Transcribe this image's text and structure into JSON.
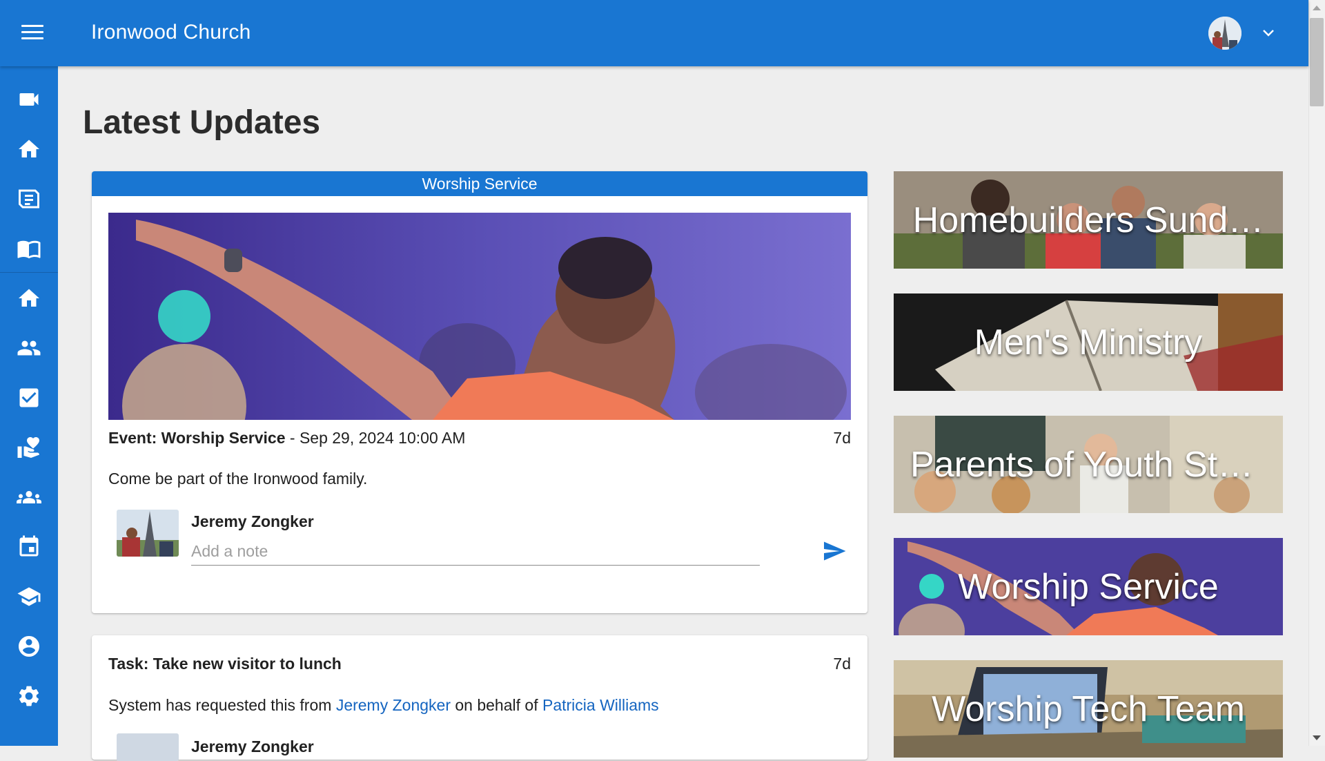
{
  "header": {
    "title": "Ironwood Church",
    "menu_icon": "menu-icon",
    "user_menu_icon": "chevron-down-icon"
  },
  "sidebar": {
    "items": [
      {
        "icon": "video-camera-icon",
        "label": "Stream"
      },
      {
        "icon": "home-icon",
        "label": "Home"
      },
      {
        "icon": "sermon-icon",
        "label": "Sermons"
      },
      {
        "icon": "bible-icon",
        "label": "Bible"
      },
      {
        "icon": "home-icon",
        "label": "Dashboard"
      },
      {
        "icon": "people-icon",
        "label": "People"
      },
      {
        "icon": "checkbox-icon",
        "label": "Tasks"
      },
      {
        "icon": "volunteer-icon",
        "label": "Serving"
      },
      {
        "icon": "groups-icon",
        "label": "Groups"
      },
      {
        "icon": "calendar-icon",
        "label": "Calendar"
      },
      {
        "icon": "school-icon",
        "label": "Classes"
      },
      {
        "icon": "account-icon",
        "label": "Profile"
      },
      {
        "icon": "settings-icon",
        "label": "Settings"
      }
    ]
  },
  "main": {
    "title": "Latest Updates",
    "event_card": {
      "header": "Worship Service",
      "event_label": "Event: Worship Service",
      "event_date": " - Sep 29, 2024 10:00 AM",
      "time_ago": "7d",
      "description": "Come be part of the Ironwood family.",
      "note_author": "Jeremy Zongker",
      "note_placeholder": "Add a note"
    },
    "task_card": {
      "title": "Task: Take new visitor to lunch",
      "time_ago": "7d",
      "body_prefix": "System has requested this from ",
      "requested_from": "Jeremy Zongker",
      "body_middle": " on behalf of ",
      "on_behalf_of": "Patricia Williams",
      "note_author": "Jeremy Zongker"
    }
  },
  "groups": [
    {
      "label": "Homebuilders Sund…"
    },
    {
      "label": "Men's Ministry"
    },
    {
      "label": "Parents of Youth Stu…"
    },
    {
      "label": "Worship Service"
    },
    {
      "label": "Worship Tech Team"
    }
  ],
  "colors": {
    "primary": "#1976d2",
    "link": "#1565c0",
    "background": "#eeeeee"
  }
}
